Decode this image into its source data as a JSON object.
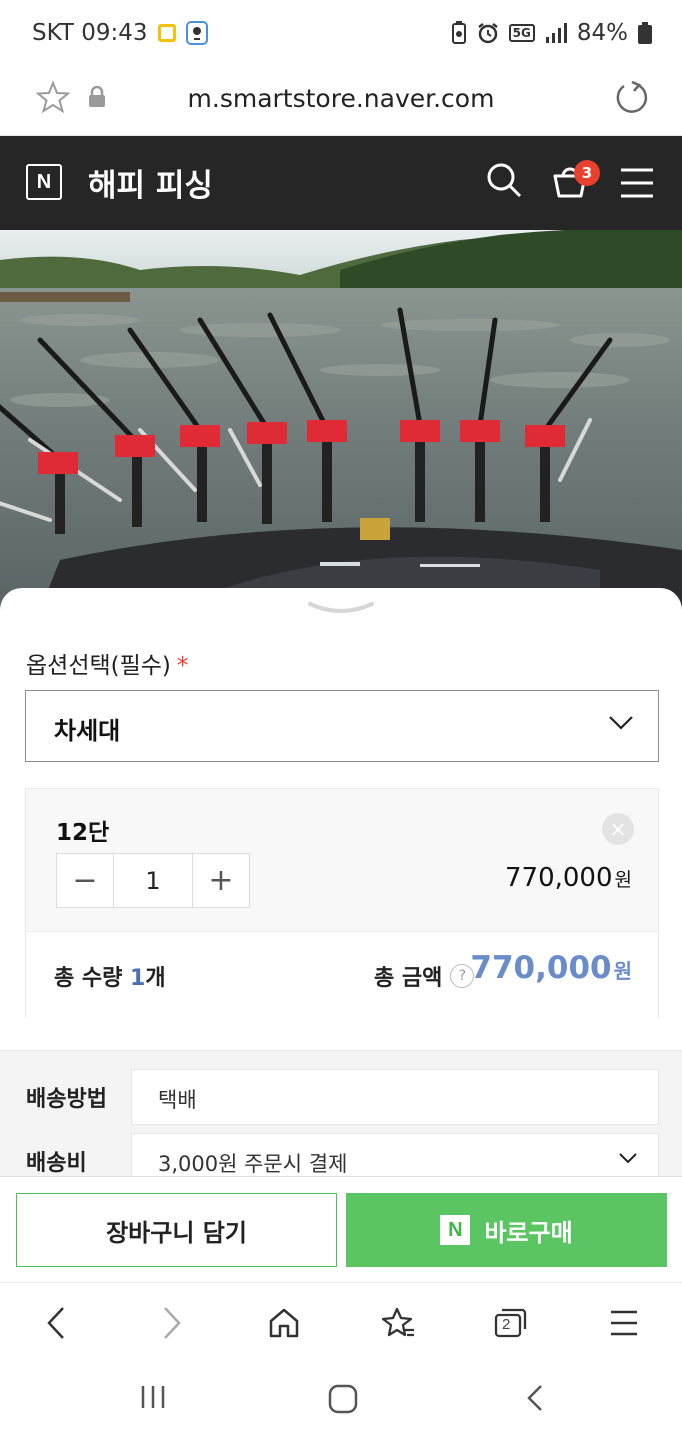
{
  "status_bar": {
    "carrier_time": "SKT 09:43",
    "battery": "84%",
    "network": "5G"
  },
  "url_bar": {
    "url": "m.smartstore.naver.com"
  },
  "store_header": {
    "logo": "N",
    "store_name": "해피 피싱",
    "cart_count": "3"
  },
  "option": {
    "label": "옵션선택(필수)",
    "required_mark": "*",
    "selected_value": "차세대"
  },
  "selected_item": {
    "name": "12단",
    "quantity": "1",
    "price": "770,000",
    "currency": "원",
    "minus": "−",
    "plus": "+",
    "remove": "×"
  },
  "totals": {
    "qty_prefix": "총 수량 ",
    "qty_value": "1",
    "qty_suffix": "개",
    "amount_label": "총 금액",
    "help": "?",
    "amount": "770,000",
    "currency": "원"
  },
  "shipping": {
    "method_label": "배송방법",
    "method_value": "택배",
    "fee_label": "배송비",
    "fee_value": "3,000원 주문시 결제"
  },
  "actions": {
    "add_to_cart": "장바구니 담기",
    "buy_now": "바로구매",
    "npay_logo": "N"
  },
  "browser_nav": {
    "tab_count": "2"
  },
  "colors": {
    "header_bg": "#262626",
    "accent_green": "#5bc463",
    "total_blue": "#6a8cc9",
    "badge_red": "#e8412f"
  }
}
